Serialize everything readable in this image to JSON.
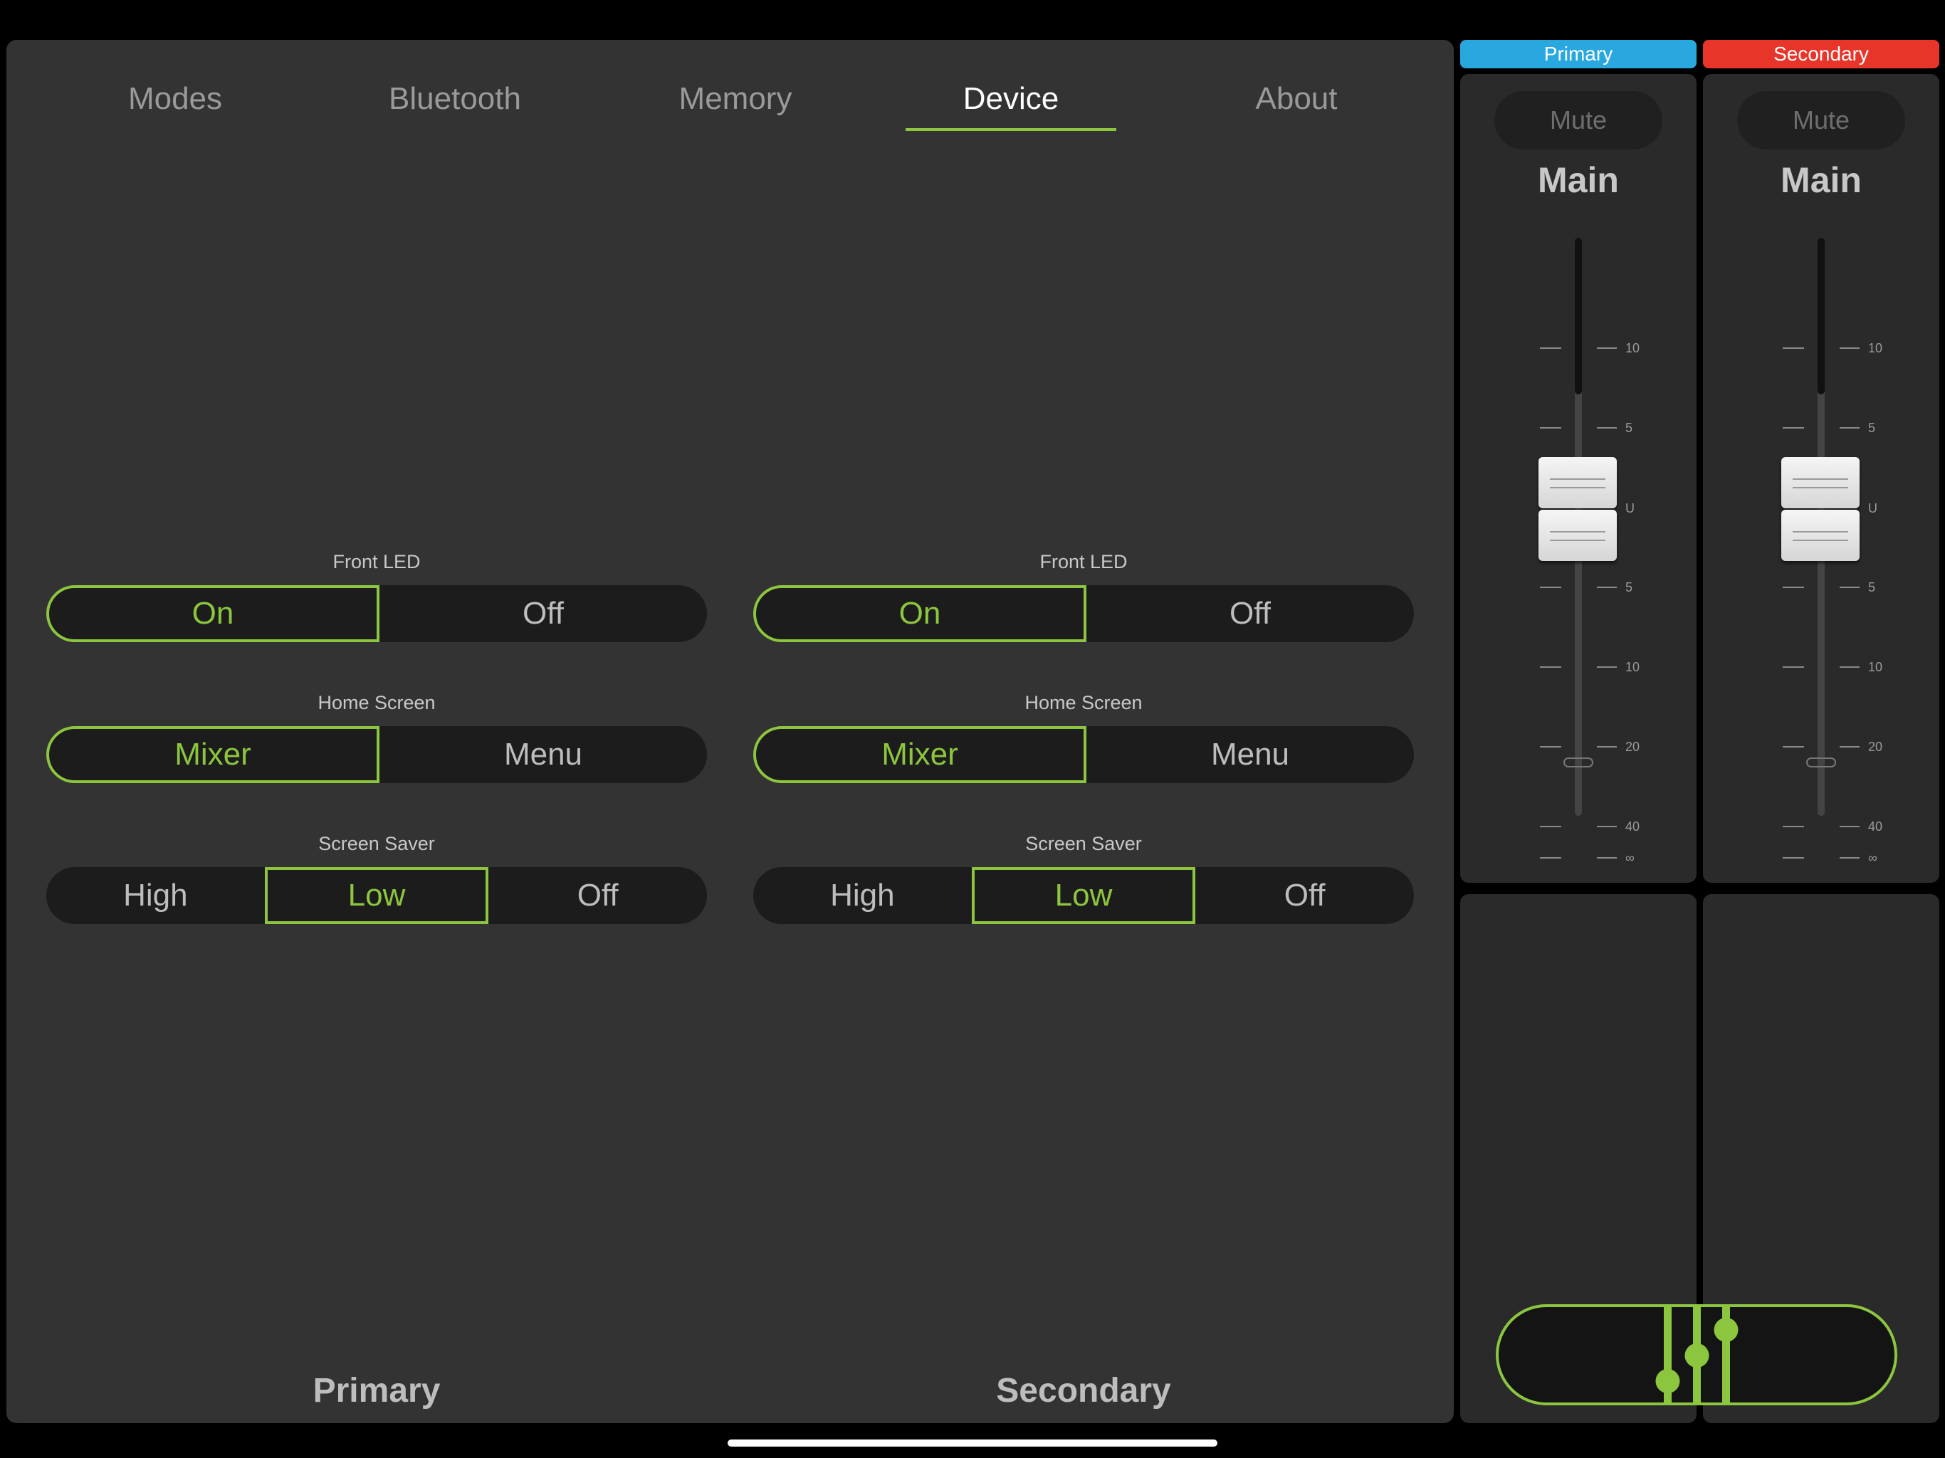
{
  "tabs": [
    {
      "label": "Modes",
      "active": false
    },
    {
      "label": "Bluetooth",
      "active": false
    },
    {
      "label": "Memory",
      "active": false
    },
    {
      "label": "Device",
      "active": true
    },
    {
      "label": "About",
      "active": false
    }
  ],
  "device": {
    "primary": {
      "footer": "Primary",
      "front_led": {
        "label": "Front LED",
        "options": [
          "On",
          "Off"
        ],
        "selected": "On"
      },
      "home_screen": {
        "label": "Home Screen",
        "options": [
          "Mixer",
          "Menu"
        ],
        "selected": "Mixer"
      },
      "screen_saver": {
        "label": "Screen Saver",
        "options": [
          "High",
          "Low",
          "Off"
        ],
        "selected": "Low"
      }
    },
    "secondary": {
      "footer": "Secondary",
      "front_led": {
        "label": "Front LED",
        "options": [
          "On",
          "Off"
        ],
        "selected": "On"
      },
      "home_screen": {
        "label": "Home Screen",
        "options": [
          "Mixer",
          "Menu"
        ],
        "selected": "Mixer"
      },
      "screen_saver": {
        "label": "Screen Saver",
        "options": [
          "High",
          "Low",
          "Off"
        ],
        "selected": "Low"
      }
    }
  },
  "strips": [
    {
      "header": "Primary",
      "header_color": "#29a8e0",
      "mute": "Mute",
      "title": "Main"
    },
    {
      "header": "Secondary",
      "header_color": "#e8352a",
      "mute": "Mute",
      "title": "Main"
    }
  ],
  "fader_scale": [
    "10",
    "5",
    "U",
    "5",
    "10",
    "20",
    "40",
    "∞"
  ],
  "accent_color": "#8cc63f"
}
